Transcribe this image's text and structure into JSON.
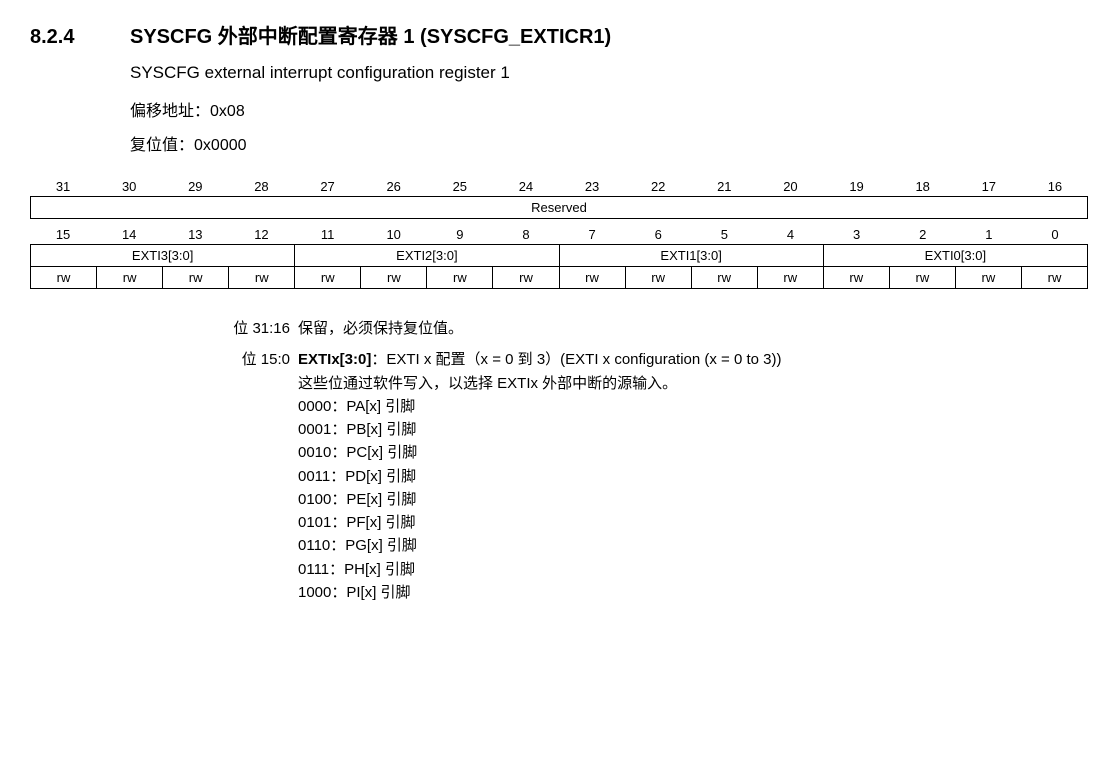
{
  "section_number": "8.2.4",
  "section_title": "SYSCFG 外部中断配置寄存器 1 (SYSCFG_EXTICR1)",
  "subtitle": "SYSCFG external interrupt configuration register 1",
  "offset_label": "偏移地址：",
  "offset_value": "0x08",
  "reset_label": "复位值：",
  "reset_value": "0x0000",
  "bits_high": [
    "31",
    "30",
    "29",
    "28",
    "27",
    "26",
    "25",
    "24",
    "23",
    "22",
    "21",
    "20",
    "19",
    "18",
    "17",
    "16"
  ],
  "bits_low": [
    "15",
    "14",
    "13",
    "12",
    "11",
    "10",
    "9",
    "8",
    "7",
    "6",
    "5",
    "4",
    "3",
    "2",
    "1",
    "0"
  ],
  "reserved_label": "Reserved",
  "fields": [
    "EXTI3[3:0]",
    "EXTI2[3:0]",
    "EXTI1[3:0]",
    "EXTI0[3:0]"
  ],
  "rw": "rw",
  "bit31_16_label": "位 31:16",
  "bit31_16_text": "保留，必须保持复位值。",
  "bit15_0_label": "位 15:0",
  "bit15_0_name": "EXTIx[3:0]",
  "bit15_0_colon": "：",
  "bit15_0_desc": "EXTI x 配置（x = 0 到 3）(EXTI x configuration (x = 0 to 3))",
  "bit15_0_sub": "这些位通过软件写入，以选择 EXTIx 外部中断的源输入。",
  "encodings": [
    "0000：PA[x] 引脚",
    "0001：PB[x] 引脚",
    "0010：PC[x] 引脚",
    "0011：PD[x] 引脚",
    "0100：PE[x] 引脚",
    "0101：PF[x] 引脚",
    "0110：PG[x] 引脚",
    "0111：PH[x] 引脚",
    "1000：PI[x] 引脚"
  ]
}
